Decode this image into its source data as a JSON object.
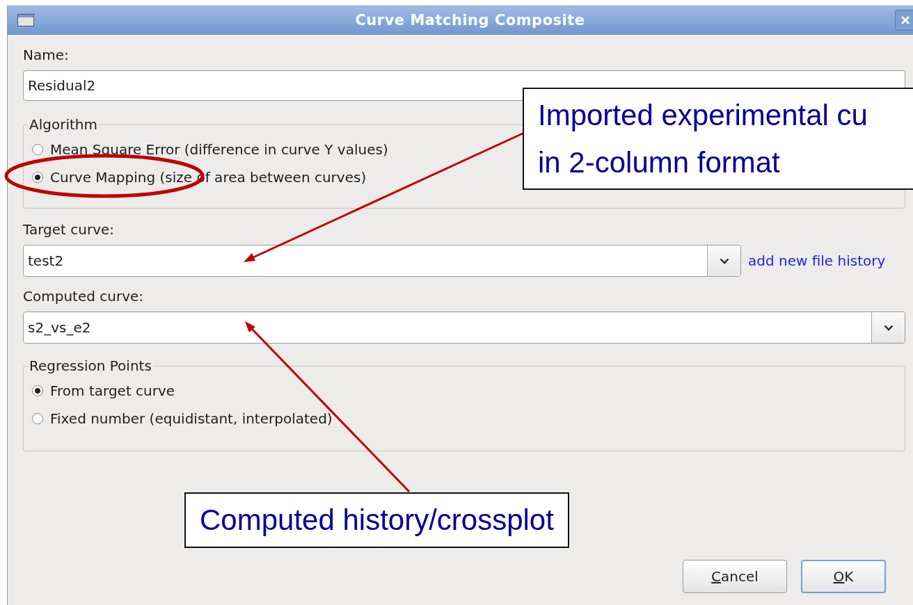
{
  "window": {
    "title": "Curve Matching Composite"
  },
  "name_field": {
    "label": "Name:",
    "value": "Residual2"
  },
  "algorithm": {
    "legend": "Algorithm",
    "options": [
      {
        "label": "Mean Square Error (difference in curve Y values)",
        "selected": false
      },
      {
        "label": "Curve Mapping (size of area between curves)",
        "selected": true
      }
    ]
  },
  "target_curve": {
    "label": "Target curve:",
    "value": "test2",
    "link": "add new file history"
  },
  "computed_curve": {
    "label": "Computed curve:",
    "value": "s2_vs_e2"
  },
  "regression_points": {
    "legend": "Regression Points",
    "options": [
      {
        "label": "From target curve",
        "selected": true
      },
      {
        "label": "Fixed number (equidistant, interpolated)",
        "selected": false
      }
    ]
  },
  "buttons": [
    {
      "label_parts": [
        "C",
        "ancel"
      ],
      "default": false
    },
    {
      "label_parts": [
        "O",
        "K"
      ],
      "default": true
    }
  ],
  "annotations": [
    {
      "kind": "callout",
      "lines": [
        "Imported experimental cu",
        "in 2-column format"
      ]
    },
    {
      "kind": "callout",
      "lines": [
        "Computed history/crossplot"
      ]
    }
  ]
}
